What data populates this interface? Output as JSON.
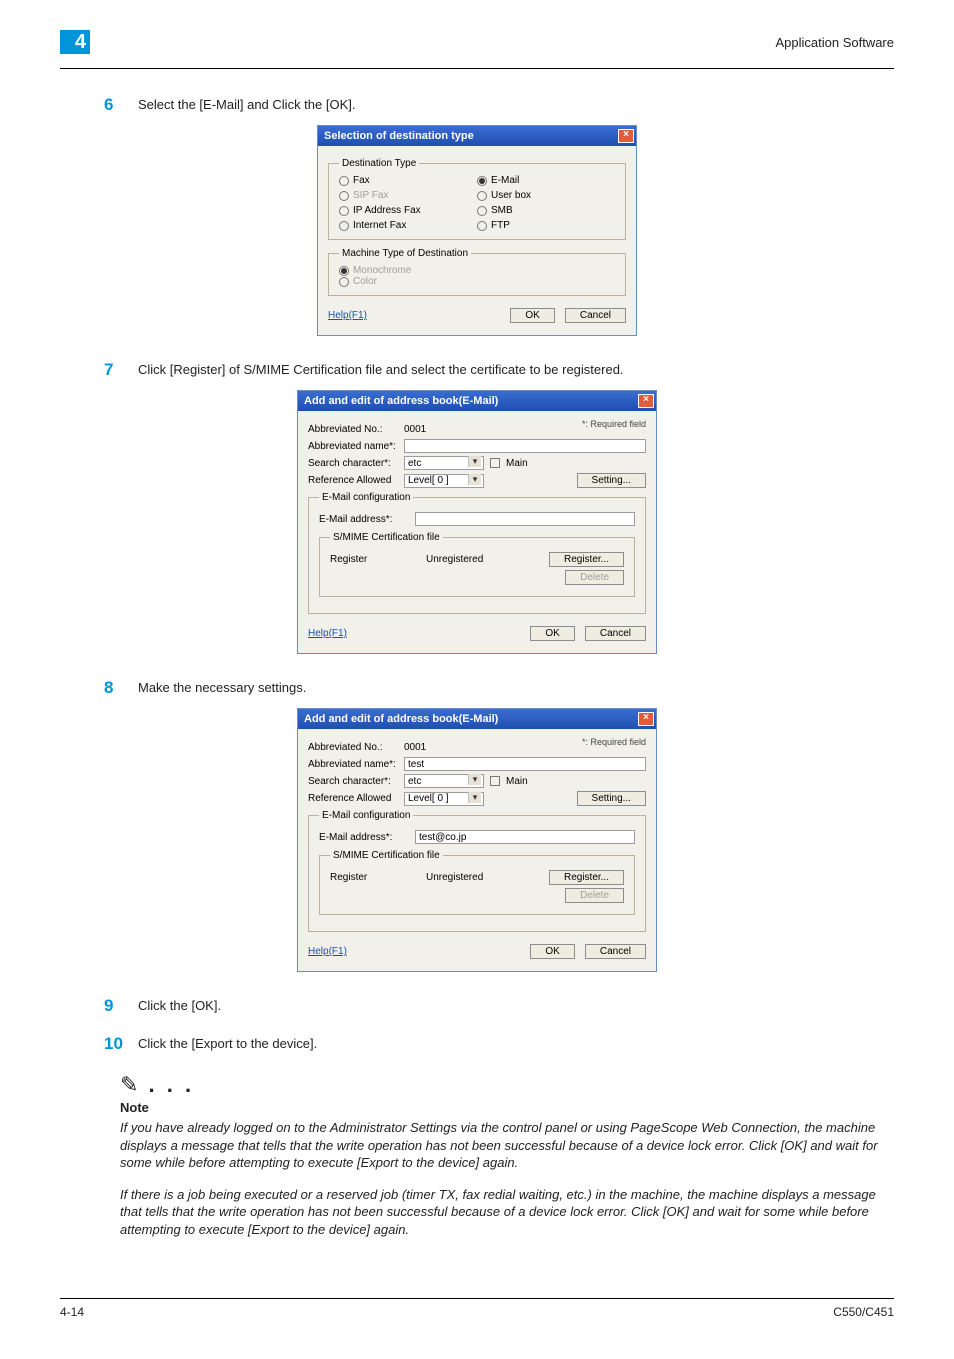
{
  "header": {
    "chapter_number": "4",
    "section_title": "Application Software"
  },
  "steps": {
    "s6": {
      "num": "6",
      "text": "Select the [E-Mail] and Click the [OK]."
    },
    "s7": {
      "num": "7",
      "text": "Click [Register] of S/MIME Certification file and select the certificate to be registered."
    },
    "s8": {
      "num": "8",
      "text": "Make the necessary settings."
    },
    "s9": {
      "num": "9",
      "text": "Click the [OK]."
    },
    "s10": {
      "num": "10",
      "text": "Click the [Export to the device]."
    }
  },
  "dialog1": {
    "title": "Selection of destination type",
    "group1_legend": "Destination Type",
    "options": {
      "fax": "Fax",
      "sipfax": "SIP Fax",
      "ipfax": "IP Address Fax",
      "internetfax": "Internet Fax",
      "email": "E-Mail",
      "userbox": "User box",
      "smb": "SMB",
      "ftp": "FTP"
    },
    "group2_legend": "Machine Type of Destination",
    "machine_mono": "Monochrome",
    "machine_color": "Color",
    "help": "Help(F1)",
    "ok": "OK",
    "cancel": "Cancel"
  },
  "dialog2": {
    "title": "Add and edit of address book(E-Mail)",
    "required": "*: Required field",
    "labels": {
      "abbrev_no": "Abbreviated No.:",
      "abbrev_name": "Abbreviated name*:",
      "search": "Search character*:",
      "ref_allowed": "Reference Allowed",
      "main": "Main",
      "setting": "Setting...",
      "email_conf_legend": "E-Mail configuration",
      "email_addr": "E-Mail address*:",
      "smime_legend": "S/MIME Certification file",
      "register_status": "Register",
      "register_btn": "Register...",
      "delete": "Delete"
    },
    "values": {
      "abbrev_no": "0001",
      "abbrev_name": "",
      "search": "etc",
      "level": "Level[ 0 ]",
      "email": "",
      "cert_status": "Unregistered"
    },
    "help": "Help(F1)",
    "ok": "OK",
    "cancel": "Cancel"
  },
  "dialog3": {
    "title": "Add and edit of address book(E-Mail)",
    "required": "*: Required field",
    "values": {
      "abbrev_no": "0001",
      "abbrev_name": "test",
      "search": "etc",
      "level": "Level[ 0 ]",
      "email": "test@co.jp",
      "cert_status": "Unregistered"
    }
  },
  "note": {
    "heading": "Note",
    "body1": "If you have already logged on to the Administrator Settings via the control panel or using PageScope Web Connection, the machine displays a message that tells that the write operation has not been successful because of a device lock error. Click [OK] and wait for some while before attempting to execute [Export to the device] again.",
    "body2": "If there is a job being executed or a reserved job (timer TX, fax redial waiting, etc.) in the machine, the machine displays a message that tells that the write operation has not been successful because of a device lock error. Click [OK] and wait for some while before attempting to execute [Export to the device] again."
  },
  "footer": {
    "left": "4-14",
    "right": "C550/C451"
  }
}
